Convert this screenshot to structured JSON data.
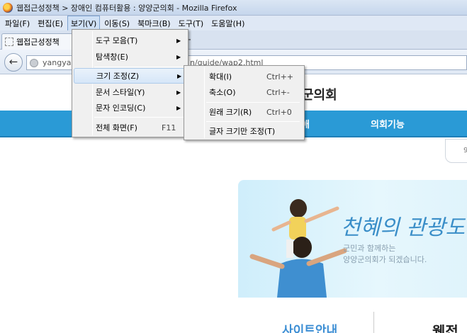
{
  "window": {
    "title": "웹접근성정책 > 장애인 컴퓨터활용 : 양양군의회 - Mozilla Firefox"
  },
  "menubar": [
    "파일(F)",
    "편집(E)",
    "보기(V)",
    "이동(S)",
    "북마크(B)",
    "도구(T)",
    "도움말(H)"
  ],
  "tab": {
    "title": "웹접근성정책",
    "new_tab": "+"
  },
  "nav": {
    "back": "←",
    "url_left": "yangyan",
    "url_right": "n/guide/wap2.html"
  },
  "view_menu": {
    "toolbars": "도구 모음(T)",
    "sidebar": "탐색창(E)",
    "zoom": "크기 조정(Z)",
    "page_style": "문서 스타일(Y)",
    "encoding": "문자 인코딩(C)",
    "fullscreen": "전체 화면(F)",
    "fullscreen_key": "F11"
  },
  "zoom_menu": {
    "zoom_in": "확대(I)",
    "zoom_in_key": "Ctrl++",
    "zoom_out": "축소(O)",
    "zoom_out_key": "Ctrl+-",
    "reset": "원래 크기(R)",
    "reset_key": "Ctrl+0",
    "text_only": "글자 크기만 조정(T)"
  },
  "page": {
    "site_title": "군의회",
    "gnb_partial": "애",
    "gnb_item": "의회기능",
    "search_partial": "9",
    "banner_headline": "천혜의 관광도시",
    "banner_sub1": "군민과 함께하는",
    "banner_sub2": "양양군의회가 되겠습니다.",
    "sitemap": "사이트안내",
    "right_partial": "웹접"
  },
  "colors": {
    "gnb": "#2a9ad6",
    "highlight": "#d6e6f8",
    "sitemap": "#3c8ed4"
  }
}
